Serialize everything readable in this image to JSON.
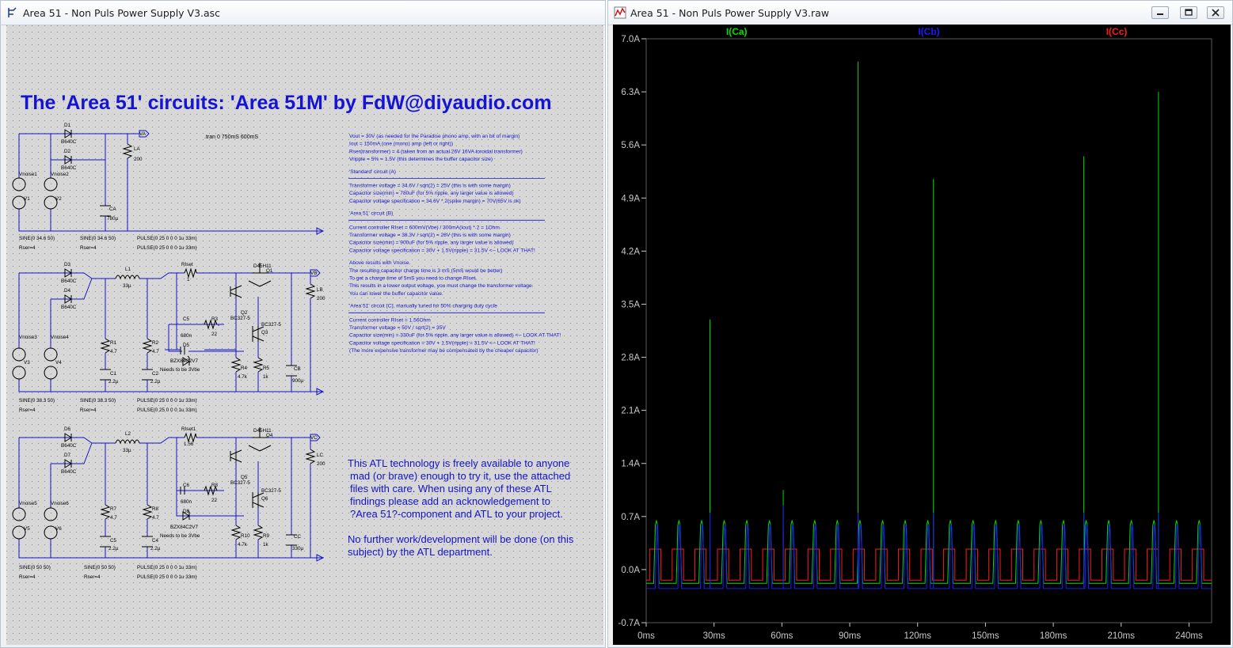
{
  "schematic_window": {
    "title": "Area 51 - Non Puls Power Supply V3.asc",
    "heading": "The 'Area 51' circuits: 'Area 51M' by FdW@diyaudio.com",
    "train_directive": ".tran 0 750mS 600mS",
    "notes_top": [
      "Vout = 30V (as needed for the Paradise phono amp, with an bit of margin)",
      "Iout = 150mA (one (mono) amp (left or right))",
      "Rser(transformer) = 4 (taken from an actual 26V 16VA toroidal transformer)",
      "Vripple = 5% = 1.5V (this determines the buffer capacitor size)",
      "",
      "'Standard' circuit (A)",
      "---",
      "Transformer voltage = 34.6V / sqrt(2) = 25V (this is with some margin)",
      "Capacitor size(min) = 780uF (for 5% ripple, any larger value is allowed)",
      "Capacitor voltage specification = 34.6V * 2(spike margin) = 70V(65V is ok)",
      "",
      "'Area 51' circuit (B)",
      "---",
      "Current controller RIset = 600mV(Vbe) / 300mA(Iout) * 2 = 1Ohm",
      "Transformer voltage = 38.3V / sqrt(2) = 28V (this is with some margin)",
      "Capacitor size(min) = 900uF (for 5% ripple, any larger value is allowed)",
      "Capacitor voltage specification = 30V + 1.5V(ripple) = 31.5V <-- LOOK AT THAT!",
      "",
      "Above results with Vnoise.",
      "The resulting capacitor charge time is 3 mS (5mS would be better)",
      "To get a charge time of 5mS you need to change RIset.",
      "This results in a lower output voltage, you must change the transformer voltage.",
      "You can lower the buffer capacitor value.",
      "",
      "'Area 51' circuit (C), manually tuned for 50% charging duty cycle",
      "---",
      "Current controller RIset = 1.56Ohm",
      "Transformer voltage = 50V / sqrt(2) = 35V",
      "Capacitor size(min) = 330uF (for 5% ripple, any larger value is allowed) <-- LOOK AT THAT!",
      "Capacitor voltage specification = 30V + 1.5V(ripple) = 31.5V <-- LOOK AT THAT!",
      "(The more expensive transformer may be compensated by the cheaper capacitor)"
    ],
    "atl_note": [
      "This ATL technology is freely available to anyone",
      "mad (or brave) enough to try it, use the attached",
      "files with care. When using any of these ATL",
      "findings please add an acknowledgement to",
      "?Area 51?-component and ATL to your project."
    ],
    "atl_note2": [
      "No further work/development will be done (on this",
      "subject) by the ATL department."
    ],
    "circuit_a": {
      "d1": "D1",
      "d1_part": "B640C",
      "d2": "D2",
      "d2_part": "B640C",
      "vnoise1": "Vnoise1",
      "vnoise2": "Vnoise2",
      "v1": "V1",
      "v2": "V2",
      "ca": "CA",
      "ca_val": "780µ",
      "la": "LA",
      "la_val": "200",
      "out": "VA",
      "src1": "SINE(0 34.6 50)",
      "src2": "SINE(0 34.6 50)",
      "pulse": "PULSE(0 25 0 0 0 1u 33m)",
      "rser1": "Rser=4",
      "rser2": "Rser=4",
      "pulse2": "PULSE(0 25 0 0 0 1u 33m)"
    },
    "circuit_b": {
      "d3": "D3",
      "d3_part": "B640C",
      "d4": "D4",
      "d4_part": "B640C",
      "l": "L1",
      "l_val": "33µ",
      "riset": "RIset",
      "riset_val": "1",
      "q1": "Q1",
      "q1_part": "D45H11",
      "q2": "Q2",
      "q2_part": "BC327-5",
      "q3": "Q3",
      "q3_part": "BC327-5",
      "c5": "C5",
      "c5_val": "680n",
      "r3": "R3",
      "r3_val": "22",
      "d5": "D5",
      "d5_part": "BZX84C2V7",
      "needs": "Needs to be 3Vbe",
      "r1": "R1",
      "r1_val": "4.7",
      "r2": "R2",
      "r2_val": "4.7",
      "c1": "C1",
      "c1_val": "2.2µ",
      "c2": "C2",
      "c2_val": "2.2µ",
      "r4": "R4",
      "r4_val": "4.7k",
      "r5": "R5",
      "r5_val": "1k",
      "cb": "CB",
      "cb_val": "900µ",
      "lb": "LB",
      "lb_val": "200",
      "out": "VB",
      "vnoise3": "Vnoise3",
      "vnoise4": "Vnoise4",
      "v3": "V3",
      "v4": "V4",
      "src1": "SINE(0 38.3 50)",
      "src2": "SINE(0 38.3 50)",
      "pulse": "PULSE(0 25 0 0 0 1u 33m)",
      "rser1": "Rser=4",
      "rser2": "Rser=4",
      "pulse2": "PULSE(0 25 0 0 0 1u 33m)"
    },
    "circuit_c": {
      "d6": "D6",
      "d6_part": "B640C",
      "d7": "D7",
      "d7_part": "B640C",
      "l": "L2",
      "l_val": "33µ",
      "riset": "RIset1",
      "riset_val": "1.56",
      "q4": "Q4",
      "q4_part": "D45H11",
      "q5": "Q5",
      "q5_part": "BC327-5",
      "q6": "Q6",
      "q6_part": "BC327-5",
      "c6": "C6",
      "c6_val": "680n",
      "r8": "R8",
      "r8_val": "22",
      "d8": "D8",
      "d8_part": "BZX84C2V7",
      "needs": "Needs to be 3Vbe",
      "r7": "R7",
      "r7_val": "4.7",
      "r8b": "R8",
      "r8b_val": "4.7",
      "c5": "C5",
      "c5_val": "2.2µ",
      "c4": "C4",
      "c4_val": "2.2µ",
      "r10": "R10",
      "r10_val": "4.7k",
      "r9": "R9",
      "r9_val": "1k",
      "cc": "CC",
      "cc_val": "330µ",
      "lc": "LC",
      "lc_val": "200",
      "out": "VC",
      "vnoise5": "Vnoise5",
      "vnoise6": "Vnoise6",
      "v5": "V5",
      "v6": "V6",
      "src1": "SINE(0 50 50)",
      "src2": "SINE(0 50 50)",
      "pulse": "PULSE(0 25 0 0 0 1u 33m)",
      "rser1": "Rser=4",
      "rser2": "Rser=4",
      "pulse2": "PULSE(0 25 0 0 0 1u 33m)"
    }
  },
  "plot_window": {
    "title": "Area 51 - Non Puls Power Supply V3.raw",
    "legend": [
      "I(Ca)",
      "I(Cb)",
      "I(Cc)"
    ],
    "colors": {
      "Ca": "#00dd00",
      "Cb": "#1a1aff",
      "Cc": "#ff1a1a",
      "background": "#000000",
      "axis_text": "#c8c8c8",
      "grid": "#5a5a5a"
    }
  },
  "chart_data": {
    "type": "line",
    "title": "",
    "xlabel": "",
    "ylabel": "",
    "xlim": [
      0,
      250
    ],
    "ylim": [
      -0.7,
      7.0
    ],
    "x_unit": "ms",
    "y_unit": "A",
    "x_ticks": [
      "0ms",
      "30ms",
      "60ms",
      "90ms",
      "120ms",
      "150ms",
      "180ms",
      "210ms",
      "240ms"
    ],
    "y_ticks": [
      "7.0A",
      "6.3A",
      "5.6A",
      "4.9A",
      "4.2A",
      "3.5A",
      "2.8A",
      "2.1A",
      "1.4A",
      "0.7A",
      "0.0A",
      "-0.7A"
    ],
    "grid": false,
    "legend_position": "top",
    "period_ms": 10,
    "series": [
      {
        "name": "I(Ca)",
        "peak": 0.65,
        "baseline": -0.18,
        "pulse_width_ms": 2.4,
        "spikes": [
          {
            "x": 28.2,
            "y": 3.3
          },
          {
            "x": 60.6,
            "y": 1.05
          },
          {
            "x": 93.7,
            "y": 6.7
          },
          {
            "x": 127.0,
            "y": 5.15
          },
          {
            "x": 193.5,
            "y": 5.45
          },
          {
            "x": 226.5,
            "y": 6.3
          }
        ]
      },
      {
        "name": "I(Cb)",
        "peak": 0.6,
        "baseline": -0.25,
        "pulse_width_ms": 1.6,
        "spikes": [
          {
            "x": 28.2,
            "y": 0.75
          },
          {
            "x": 60.6,
            "y": 0.85
          },
          {
            "x": 93.7,
            "y": 0.75
          },
          {
            "x": 127.0,
            "y": 0.75
          },
          {
            "x": 193.5,
            "y": 0.75
          },
          {
            "x": 226.5,
            "y": 0.75
          }
        ]
      },
      {
        "name": "I(Cc)",
        "peak": 0.27,
        "baseline": -0.14,
        "pulse_width_ms": 5.0,
        "spikes": [
          {
            "x": 60.6,
            "y": 0.5
          }
        ]
      }
    ]
  }
}
